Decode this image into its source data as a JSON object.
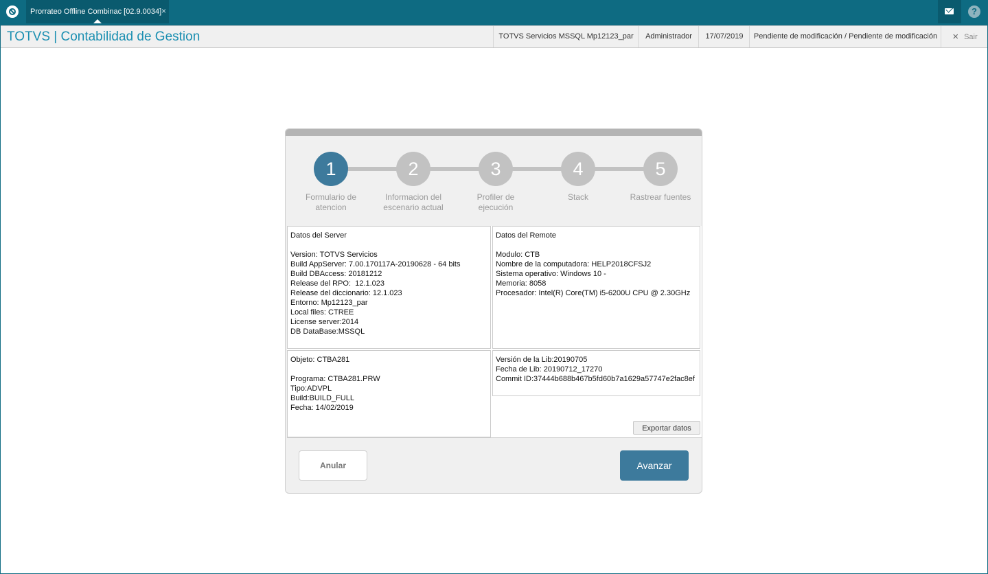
{
  "tab": {
    "label": "Prorrateo Offline Combinac [02.9.0034]",
    "close": "×"
  },
  "header": {
    "title": "TOTVS | Contabilidad de Gestion",
    "server": "TOTVS Servicios MSSQL Mp12123_par",
    "user": "Administrador",
    "date": "17/07/2019",
    "status": "Pendiente de modificación / Pendiente de modificación",
    "logout": "Sair",
    "logout_icon": "×",
    "help_icon": "?"
  },
  "steps": [
    {
      "number": "1",
      "label": "Formulario de atencion",
      "active": true
    },
    {
      "number": "2",
      "label": "Informacion del escenario actual",
      "active": false
    },
    {
      "number": "3",
      "label": "Profiler de ejecución",
      "active": false
    },
    {
      "number": "4",
      "label": "Stack",
      "active": false
    },
    {
      "number": "5",
      "label": "Rastrear fuentes",
      "active": false
    }
  ],
  "server_panel": {
    "title": "Datos del Server",
    "lines": [
      "Version: TOTVS Servicios",
      "Build AppServer: 7.00.170117A-20190628 - 64 bits",
      "Build DBAccess: 20181212",
      "Release del RPO:  12.1.023",
      "Release del diccionario: 12.1.023",
      "Entorno: Mp12123_par",
      "Local files: CTREE",
      "License server:2014",
      "DB DataBase:MSSQL"
    ]
  },
  "remote_panel": {
    "title": "Datos del Remote",
    "lines": [
      "Modulo: CTB",
      "Nombre de la computadora: HELP2018CFSJ2",
      "Sistema operativo: Windows 10 -",
      "Memoria: 8058",
      "Procesador: Intel(R) Core(TM) i5-6200U CPU @ 2.30GHz"
    ]
  },
  "object_panel": {
    "title": "Objeto: CTBA281",
    "lines": [
      "Programa: CTBA281.PRW",
      "Tipo:ADVPL",
      "Build:BUILD_FULL",
      "Fecha: 14/02/2019"
    ]
  },
  "lib_panel": {
    "lines": [
      "Versión de la Lib:20190705",
      "Fecha de Lib: 20190712_17270",
      "Commit ID:37444b688b467b5fd60b7a1629a57747e2fac8ef"
    ]
  },
  "buttons": {
    "export": "Exportar datos",
    "cancel": "Anular",
    "next": "Avanzar"
  }
}
